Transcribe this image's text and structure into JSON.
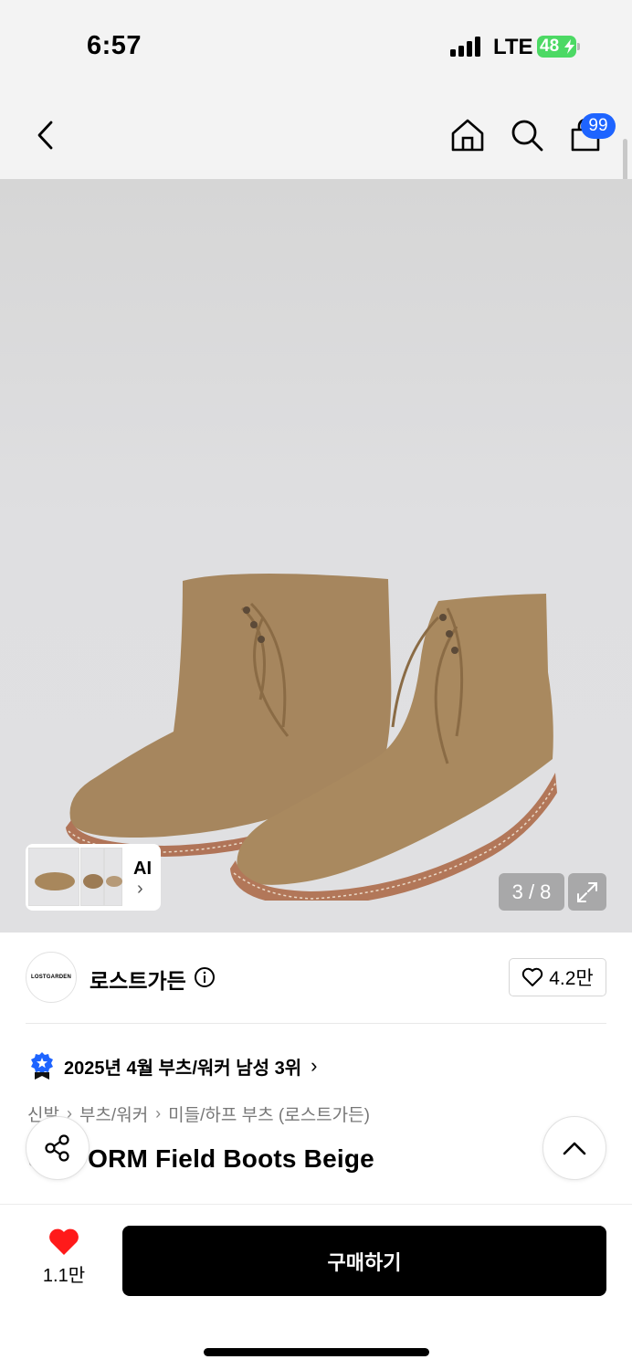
{
  "status_bar": {
    "time": "6:57",
    "network": "LTE",
    "battery_percent": "48"
  },
  "nav": {
    "cart_badge": "99",
    "icons": [
      "back-icon",
      "home-icon",
      "search-icon",
      "shopping-bag-icon"
    ]
  },
  "gallery": {
    "counter": "3 / 8",
    "ai_label": "AI",
    "ai_chevron": "›"
  },
  "brand": {
    "logo_text": "LOSTGARDEN",
    "name": "로스트가든",
    "likes": "4.2만"
  },
  "ranking": {
    "text": "2025년 4월 부츠/워커 남성 3위",
    "chevron": "›",
    "badge_color": "#1e64ff"
  },
  "breadcrumb": [
    "신발",
    "부츠/워커",
    "미들/하프 부츠 (로스트가든)"
  ],
  "breadcrumb_separator": "›",
  "product": {
    "title": "UNIFORM Field Boots Beige"
  },
  "bottom_bar": {
    "heart_count": "1.1만",
    "buy_label": "구매하기",
    "heart_color": "#ff1a1a"
  }
}
